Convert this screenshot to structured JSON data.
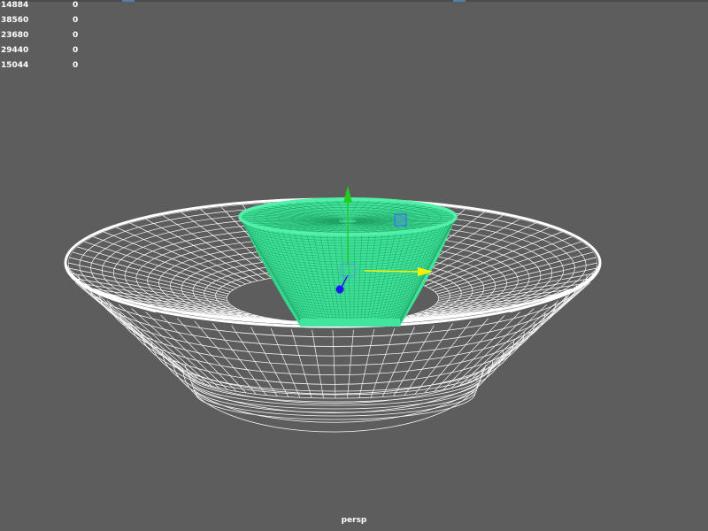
{
  "viewport": {
    "camera_label": "persp",
    "background_color": "#5d5d5d",
    "wireframe_color": "#ffffff",
    "selected_color": "#38e896"
  },
  "hud": {
    "rows": [
      {
        "a": "14884",
        "b": "0"
      },
      {
        "a": "38560",
        "b": "0"
      },
      {
        "a": "23680",
        "b": "0"
      },
      {
        "a": "29440",
        "b": "0"
      },
      {
        "a": "15044",
        "b": "0"
      }
    ]
  },
  "objects": {
    "plate": {
      "state": "wireframe"
    },
    "cup": {
      "state": "selected"
    }
  },
  "manipulator": {
    "type": "move-tool",
    "axes": {
      "x": "#ffee00",
      "y": "#22cc22",
      "z": "#1a1aff"
    }
  }
}
